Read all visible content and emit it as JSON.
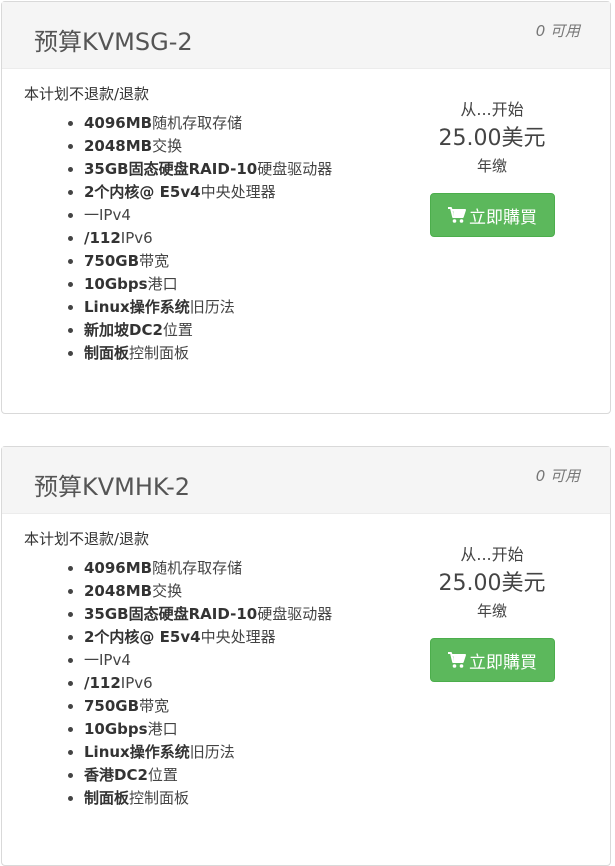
{
  "products": [
    {
      "title": "预算KVMSG-2",
      "availability": "0 可用",
      "note": "本计划不退款/退款",
      "features": [
        {
          "bold": "4096MB",
          "text": "随机存取存储"
        },
        {
          "bold": "2048MB",
          "text": "交换"
        },
        {
          "bold": "35GB固态硬盘RAID-10",
          "text": "硬盘驱动器"
        },
        {
          "bold": "2个内核@ E5v4",
          "text": "中央处理器"
        },
        {
          "bold": "",
          "text": "一IPv4"
        },
        {
          "bold": "/112",
          "text": "IPv6"
        },
        {
          "bold": "750GB",
          "text": "带宽"
        },
        {
          "bold": "10Gbps",
          "text": "港口"
        },
        {
          "bold": "Linux操作系统",
          "text": "旧历法"
        },
        {
          "bold": "新加坡DC2",
          "text": "位置"
        },
        {
          "bold": "制面板",
          "text": "控制面板"
        }
      ],
      "from_label": "从...开始",
      "price": "25.00美元",
      "cycle": "年缴",
      "buy_label": "立即購買",
      "icon": "shopping-cart-icon"
    },
    {
      "title": "预算KVMHK-2",
      "availability": "0 可用",
      "note": "本计划不退款/退款",
      "features": [
        {
          "bold": "4096MB",
          "text": "随机存取存储"
        },
        {
          "bold": "2048MB",
          "text": "交换"
        },
        {
          "bold": "35GB固态硬盘RAID-10",
          "text": "硬盘驱动器"
        },
        {
          "bold": "2个内核@ E5v4",
          "text": "中央处理器"
        },
        {
          "bold": "",
          "text": "一IPv4"
        },
        {
          "bold": "/112",
          "text": "IPv6"
        },
        {
          "bold": "750GB",
          "text": "带宽"
        },
        {
          "bold": "10Gbps",
          "text": "港口"
        },
        {
          "bold": "Linux操作系统",
          "text": "旧历法"
        },
        {
          "bold": "香港DC2",
          "text": "位置"
        },
        {
          "bold": "制面板",
          "text": "控制面板"
        }
      ],
      "from_label": "从...开始",
      "price": "25.00美元",
      "cycle": "年缴",
      "buy_label": "立即購買",
      "icon": "shopping-cart-icon"
    }
  ],
  "colors": {
    "buy_button": "#5cb85c",
    "header_bg": "#f5f5f5",
    "border": "#d9d9d9"
  }
}
